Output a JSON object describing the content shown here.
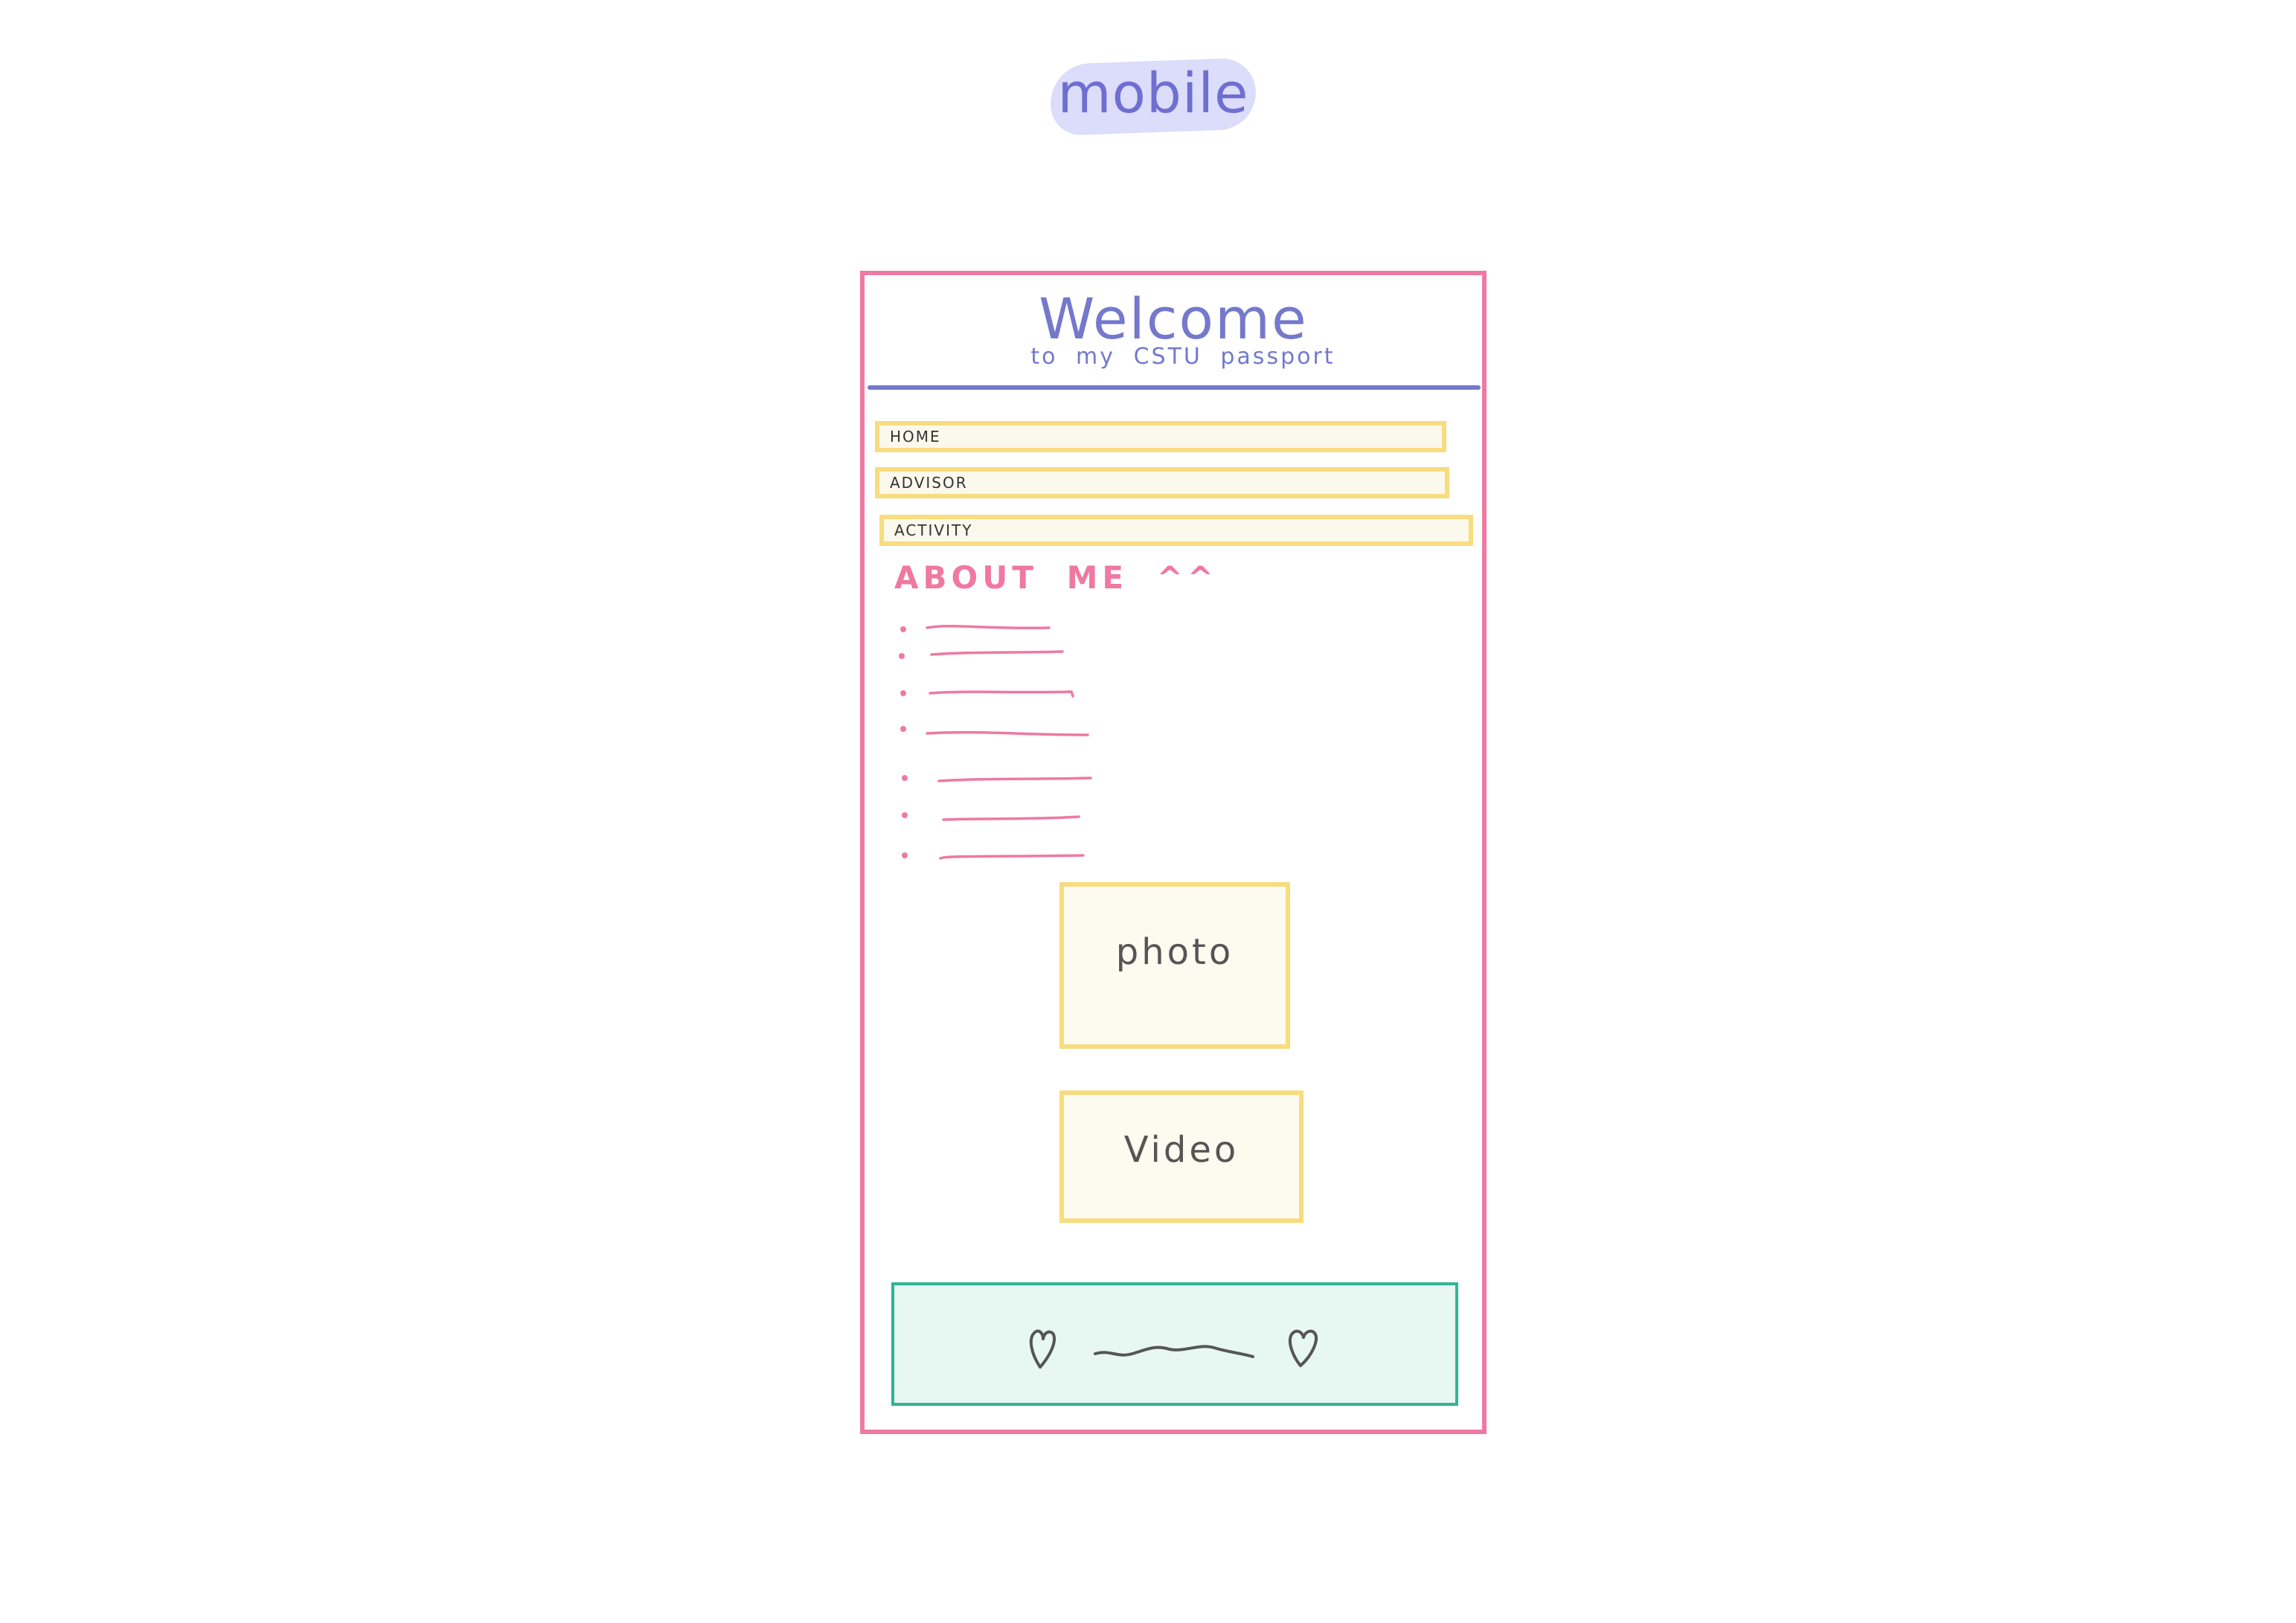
{
  "header": {
    "tag": "mobile"
  },
  "welcome": {
    "title": "Welcome",
    "subtitle": "to my CSTU passport"
  },
  "nav": {
    "items": [
      {
        "label": "HOME"
      },
      {
        "label": "ADVISOR"
      },
      {
        "label": "ACTIVITY"
      }
    ]
  },
  "about": {
    "title": "ABOUT ME ^^",
    "placeholder_line_count": 7
  },
  "media": {
    "photo_label": "photo",
    "video_label": "Video"
  },
  "colors": {
    "frame": "#ee7aa4",
    "heading": "#7479cc",
    "nav_border": "#f8dc7e",
    "about": "#ef79a0",
    "footer_border": "#30b496",
    "footer_fill": "#e7f7f2"
  },
  "footer": {
    "icons": [
      "heart-icon",
      "squiggle-line",
      "heart-icon"
    ]
  }
}
